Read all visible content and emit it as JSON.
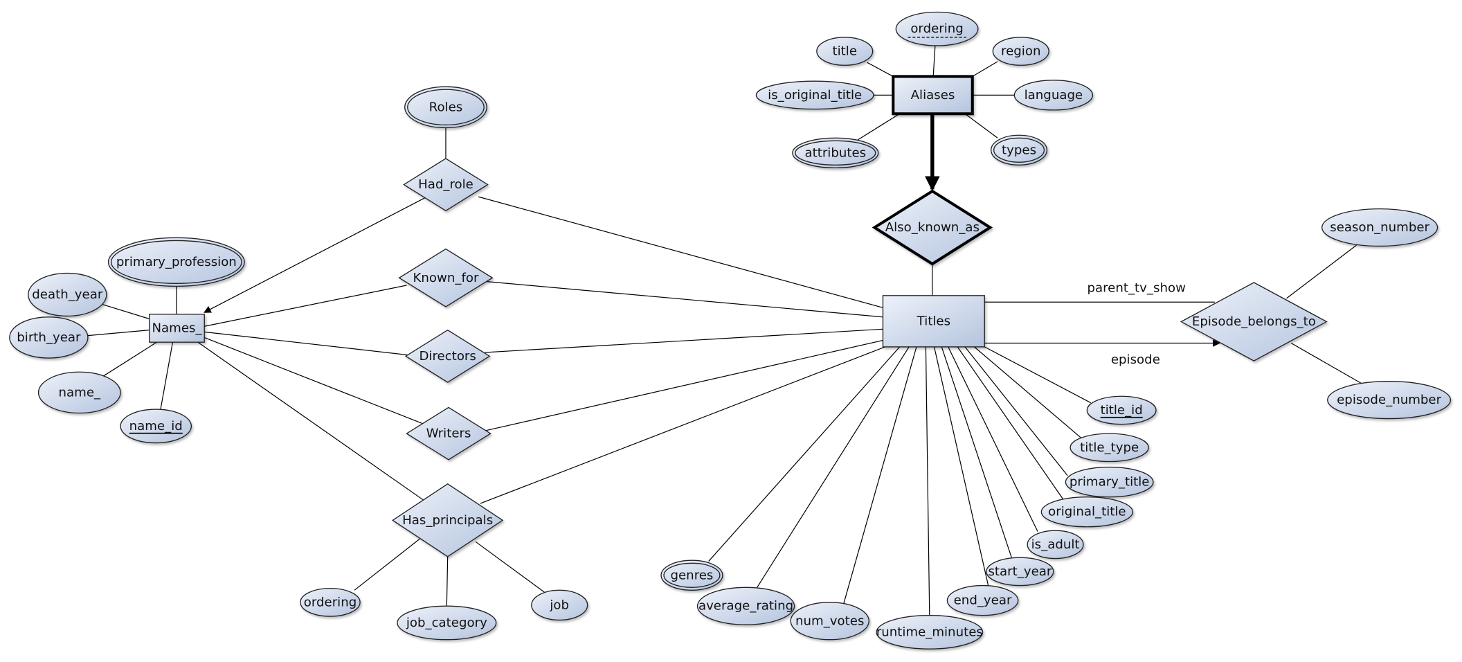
{
  "colors": {
    "fill_light": "#eef2fa",
    "fill_dark": "#b4c4de",
    "stroke": "#000000"
  },
  "entities": {
    "names": {
      "label": "Names_"
    },
    "titles": {
      "label": "Titles"
    },
    "aliases": {
      "label": "Aliases",
      "weak": true
    }
  },
  "relationships": {
    "had_role": {
      "label": "Had_role"
    },
    "known_for": {
      "label": "Known_for"
    },
    "directors": {
      "label": "Directors"
    },
    "writers": {
      "label": "Writers"
    },
    "has_principals": {
      "label": "Has_principals"
    },
    "also_known_as": {
      "label": "Also_known_as",
      "identifying": true
    },
    "episode_belongs_to": {
      "label": "Episode_belongs_to"
    }
  },
  "role_labels": {
    "parent_tv_show": "parent_tv_show",
    "episode": "episode"
  },
  "attributes": {
    "roles": {
      "label": "Roles",
      "multivalued": true
    },
    "primary_profession": {
      "label": "primary_profession",
      "multivalued": true
    },
    "death_year": {
      "label": "death_year"
    },
    "birth_year": {
      "label": "birth_year"
    },
    "name_": {
      "label": "name_"
    },
    "name_id": {
      "label": "name_id",
      "key": true
    },
    "hp_ordering": {
      "label": "ordering"
    },
    "job_category": {
      "label": "job_category"
    },
    "job": {
      "label": "job"
    },
    "al_title": {
      "label": "title"
    },
    "al_ordering": {
      "label": "ordering",
      "partial_key": true
    },
    "region": {
      "label": "region"
    },
    "is_original_title": {
      "label": "is_original_title"
    },
    "language": {
      "label": "language"
    },
    "attributes": {
      "label": "attributes",
      "multivalued": true
    },
    "types": {
      "label": "types",
      "multivalued": true
    },
    "season_number": {
      "label": "season_number"
    },
    "episode_number": {
      "label": "episode_number"
    },
    "title_id": {
      "label": "title_id",
      "key": true
    },
    "title_type": {
      "label": "title_type"
    },
    "primary_title": {
      "label": "primary_title"
    },
    "original_title": {
      "label": "original_title"
    },
    "is_adult": {
      "label": "is_adult"
    },
    "start_year": {
      "label": "start_year"
    },
    "end_year": {
      "label": "end_year"
    },
    "runtime_minutes": {
      "label": "runtime_minutes"
    },
    "num_votes": {
      "label": "num_votes"
    },
    "average_rating": {
      "label": "average_rating"
    },
    "genres": {
      "label": "genres",
      "multivalued": true
    }
  }
}
